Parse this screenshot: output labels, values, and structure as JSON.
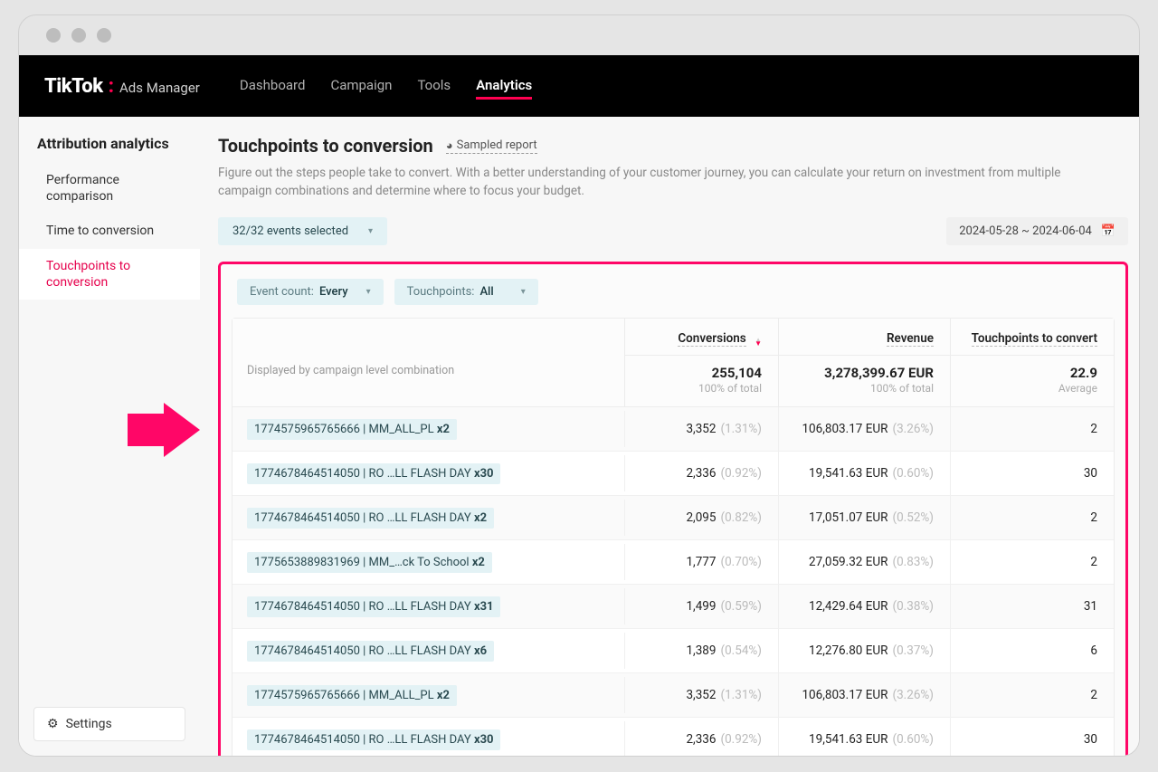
{
  "brand": {
    "name": "TikTok",
    "sub": "Ads Manager"
  },
  "nav": {
    "items": [
      "Dashboard",
      "Campaign",
      "Tools",
      "Analytics"
    ],
    "activeIndex": 3
  },
  "sidebar": {
    "title": "Attribution analytics",
    "items": [
      "Performance comparison",
      "Time to conversion",
      "Touchpoints to conversion"
    ],
    "activeIndex": 2
  },
  "settings_label": "Settings",
  "page": {
    "title": "Touchpoints to conversion",
    "sampled_label": "Sampled report",
    "description": "Figure out the steps people take to convert. With a better understanding of your customer journey, you can calculate your return on investment from multiple campaign combinations and determine where to focus your budget."
  },
  "filters": {
    "events_label": "32/32 events selected",
    "date_label": "2024-05-28 ~ 2024-06-04",
    "event_count_label": "Event count:",
    "event_count_value": "Every",
    "touchpoints_label": "Touchpoints:",
    "touchpoints_value": "All"
  },
  "table": {
    "left_header": "Displayed by campaign level combination",
    "cols": {
      "conversions": {
        "label": "Conversions",
        "total": "255,104",
        "sub": "100% of total"
      },
      "revenue": {
        "label": "Revenue",
        "total": "3,278,399.67 EUR",
        "sub": "100% of total"
      },
      "touchpoints": {
        "label": "Touchpoints to convert",
        "total": "22.9",
        "sub": "Average"
      }
    },
    "rows": [
      {
        "camp": "1774575965765666 | MM_ALL_PL",
        "mult": "x2",
        "conv": "3,352",
        "conv_pct": "(1.31%)",
        "rev": "106,803.17 EUR",
        "rev_pct": "(3.26%)",
        "tp": "2"
      },
      {
        "camp": "1774678464514050 | RO …LL FLASH DAY",
        "mult": "x30",
        "conv": "2,336",
        "conv_pct": "(0.92%)",
        "rev": "19,541.63 EUR",
        "rev_pct": "(0.60%)",
        "tp": "30"
      },
      {
        "camp": "1774678464514050 | RO …LL FLASH DAY",
        "mult": "x2",
        "conv": "2,095",
        "conv_pct": "(0.82%)",
        "rev": "17,051.07 EUR",
        "rev_pct": "(0.52%)",
        "tp": "2"
      },
      {
        "camp": "1775653889831969 | MM_…ck To School",
        "mult": "x2",
        "conv": "1,777",
        "conv_pct": "(0.70%)",
        "rev": "27,059.32 EUR",
        "rev_pct": "(0.83%)",
        "tp": "2"
      },
      {
        "camp": "1774678464514050 | RO …LL FLASH DAY",
        "mult": "x31",
        "conv": "1,499",
        "conv_pct": "(0.59%)",
        "rev": "12,429.64 EUR",
        "rev_pct": "(0.38%)",
        "tp": "31"
      },
      {
        "camp": "1774678464514050 | RO …LL FLASH DAY",
        "mult": "x6",
        "conv": "1,389",
        "conv_pct": "(0.54%)",
        "rev": "12,276.80 EUR",
        "rev_pct": "(0.37%)",
        "tp": "6"
      },
      {
        "camp": "1774575965765666 | MM_ALL_PL",
        "mult": "x2",
        "conv": "3,352",
        "conv_pct": "(1.31%)",
        "rev": "106,803.17 EUR",
        "rev_pct": "(3.26%)",
        "tp": "2"
      },
      {
        "camp": "1774678464514050 | RO …LL FLASH DAY",
        "mult": "x30",
        "conv": "2,336",
        "conv_pct": "(0.92%)",
        "rev": "19,541.63 EUR",
        "rev_pct": "(0.60%)",
        "tp": "30"
      }
    ]
  }
}
